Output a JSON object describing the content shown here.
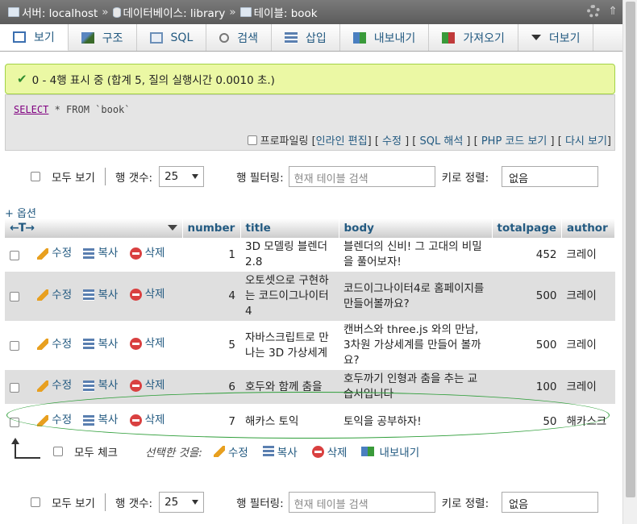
{
  "breadcrumb": {
    "server_label": "서버: localhost",
    "database_label": "데이터베이스: library",
    "table_label": "테이블: book",
    "separator": "»"
  },
  "icons": {
    "settings": "gear-icon",
    "collapse": "collapse-icon"
  },
  "tabs": [
    {
      "label": "보기",
      "icon": "browse-icon"
    },
    {
      "label": "구조",
      "icon": "structure-icon"
    },
    {
      "label": "SQL",
      "icon": "sql-icon"
    },
    {
      "label": "검색",
      "icon": "search-icon"
    },
    {
      "label": "삽입",
      "icon": "insert-icon"
    },
    {
      "label": "내보내기",
      "icon": "export-icon"
    },
    {
      "label": "가져오기",
      "icon": "import-icon"
    },
    {
      "label": "더보기",
      "icon": "more-icon"
    }
  ],
  "message": {
    "text": "0 - 4행 표시 중 (합계 5, 질의 실행시간 0.0010 초.)",
    "check": "✔"
  },
  "query": {
    "keyword": "SELECT",
    "rest": " * FROM `book`"
  },
  "query_links": {
    "profiling": "프로파일링",
    "inline_edit": "인라인 편집",
    "edit": "수정",
    "explain": "SQL 해석",
    "php_code": "PHP 코드 보기",
    "refresh": "다시 보기"
  },
  "nav": {
    "show_all": "모두 보기",
    "rows_label": "행 갯수:",
    "rows_value": "25",
    "filter_label": "행 필터링:",
    "filter_placeholder": "현재 테이블 검색",
    "sort_label": "키로 정렬:",
    "sort_value": "없음"
  },
  "options_label": "+ 옵션",
  "table": {
    "arrows": "←T→",
    "columns": [
      "number",
      "title",
      "body",
      "totalpage",
      "author"
    ],
    "action_labels": {
      "edit": "수정",
      "copy": "복사",
      "delete": "삭제"
    },
    "rows": [
      {
        "number": "1",
        "title": "3D 모델링 블렌더 2.8",
        "body": "블렌더의 신비! 그 고대의 비밀을 풀어보자!",
        "totalpage": "452",
        "author": "크레이"
      },
      {
        "number": "4",
        "title": "오토셋으로 구현하는 코드이그나이터 4",
        "body": "코드이그나이터4로 홈페이지를 만들어볼까요?",
        "totalpage": "500",
        "author": "크레이"
      },
      {
        "number": "5",
        "title": "자바스크립트로 만나는 3D 가상세계",
        "body": "캔버스와 three.js 와의 만남, 3차원 가상세계를 만들어 볼까요?",
        "totalpage": "500",
        "author": "크레이"
      },
      {
        "number": "6",
        "title": "호두와 함께 춤을",
        "body": "호두까기 인형과 춤을 추는 교습서입니다",
        "totalpage": "100",
        "author": "크레이"
      },
      {
        "number": "7",
        "title": "해카스 토익",
        "body": "토익을 공부하자!",
        "totalpage": "50",
        "author": "해카스크"
      }
    ]
  },
  "bulk": {
    "check_all": "모두 체크",
    "with_selected": "선택한 것을:",
    "edit": "수정",
    "copy": "복사",
    "delete": "삭제",
    "export": "내보내기"
  },
  "colors": {
    "link": "#235a81",
    "success_bg": "#ebf8a4",
    "highlight": "#2f9e3a"
  }
}
